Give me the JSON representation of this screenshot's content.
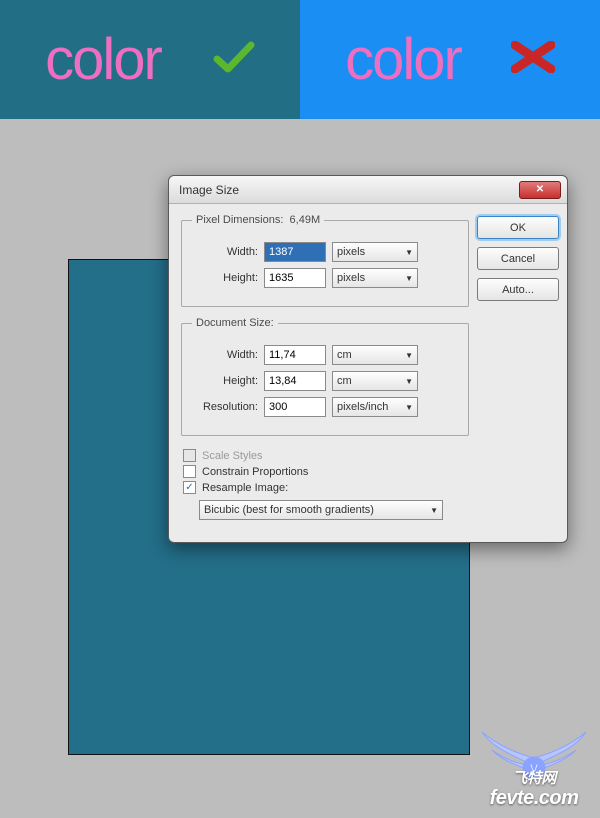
{
  "banner": {
    "left_text": "color",
    "right_text": "color"
  },
  "dialog": {
    "title": "Image Size",
    "pixel_dimensions": {
      "legend": "Pixel Dimensions:",
      "size": "6,49M",
      "width_label": "Width:",
      "width_value": "1387",
      "width_unit": "pixels",
      "height_label": "Height:",
      "height_value": "1635",
      "height_unit": "pixels"
    },
    "document_size": {
      "legend": "Document Size:",
      "width_label": "Width:",
      "width_value": "11,74",
      "width_unit": "cm",
      "height_label": "Height:",
      "height_value": "13,84",
      "height_unit": "cm",
      "resolution_label": "Resolution:",
      "resolution_value": "300",
      "resolution_unit": "pixels/inch"
    },
    "options": {
      "scale_styles": "Scale Styles",
      "constrain": "Constrain Proportions",
      "resample": "Resample Image:",
      "resample_method": "Bicubic (best for smooth gradients)"
    },
    "buttons": {
      "ok": "OK",
      "cancel": "Cancel",
      "auto": "Auto..."
    }
  },
  "watermark": {
    "brand": "飞特网",
    "url_text": "fevte.com"
  }
}
